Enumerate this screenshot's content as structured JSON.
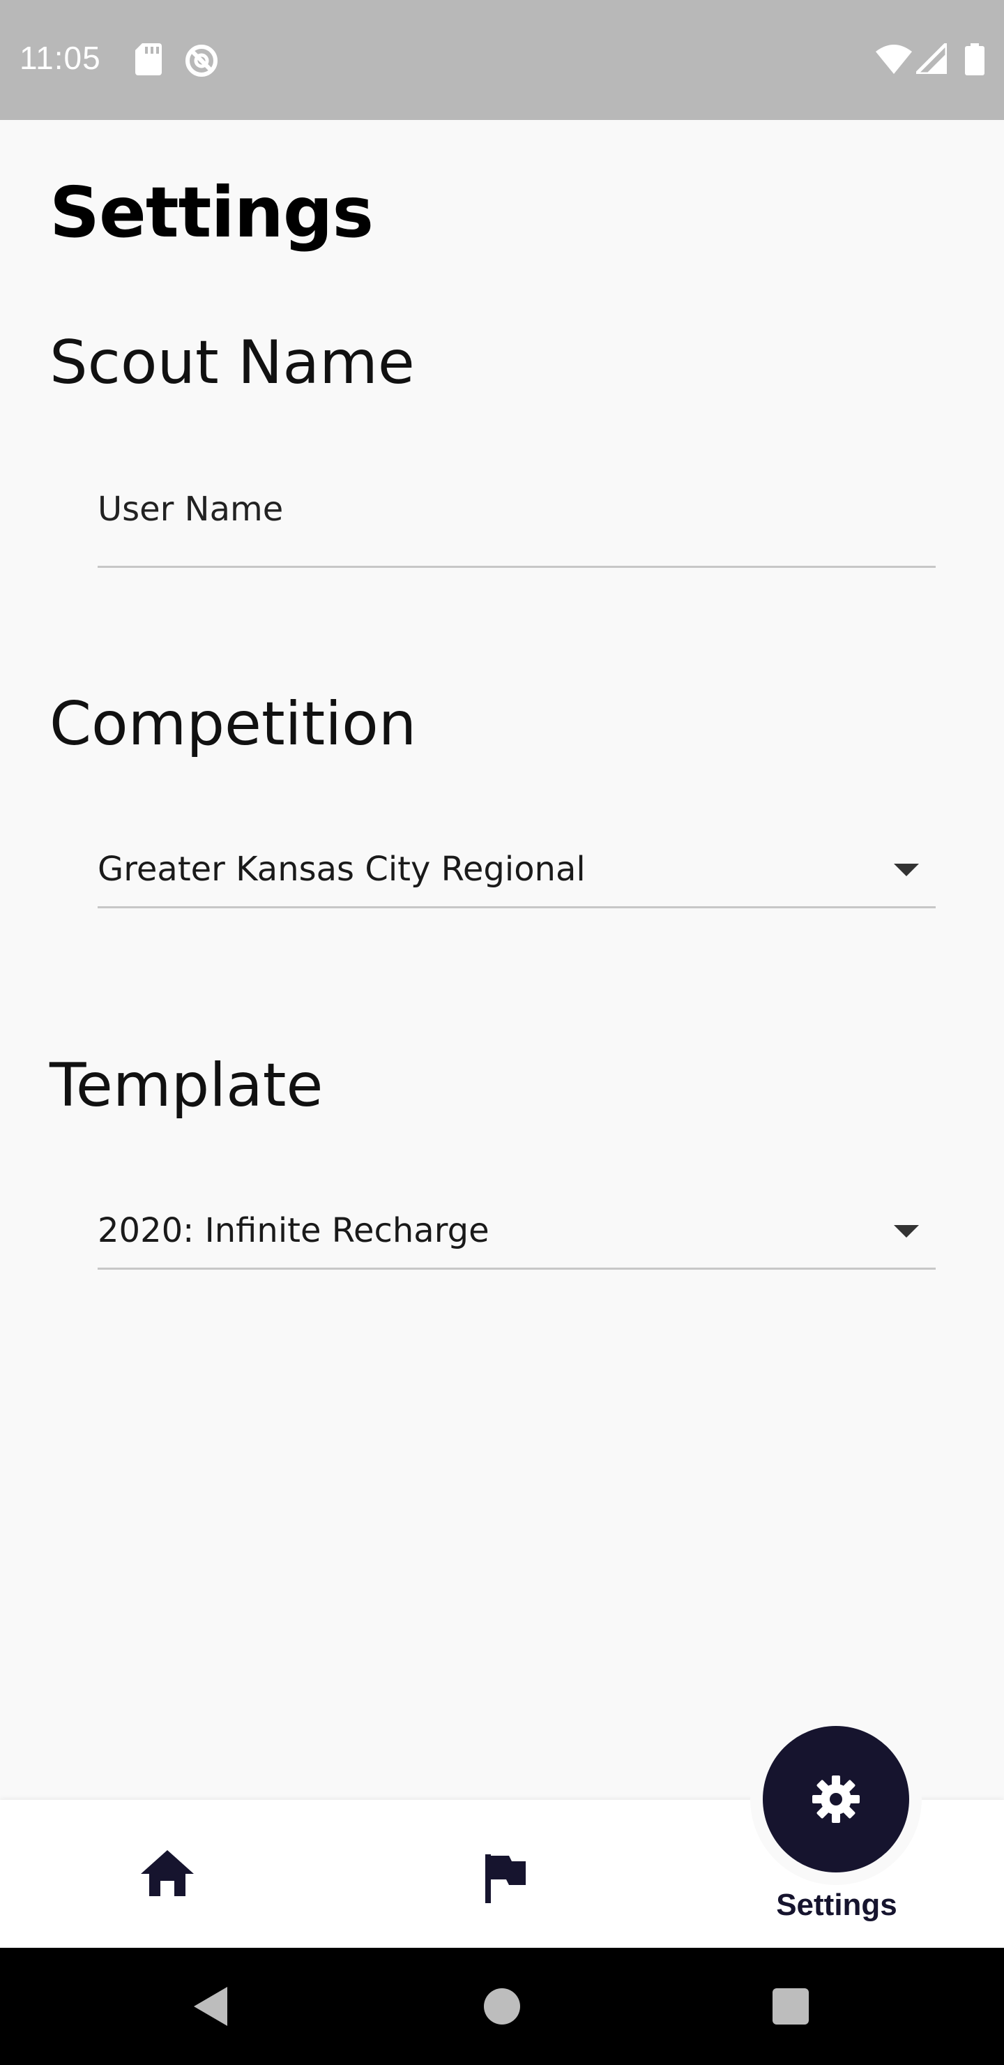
{
  "status_bar": {
    "time": "11:05",
    "icons": [
      "sd-card-icon",
      "sync-icon",
      "wifi-icon",
      "signal-icon",
      "battery-icon"
    ]
  },
  "page": {
    "title": "Settings"
  },
  "scout_name": {
    "section_title": "Scout Name",
    "input_value": "User Name"
  },
  "competition": {
    "section_title": "Competition",
    "selected_value": "Greater Kansas City Regional"
  },
  "template": {
    "section_title": "Template",
    "selected_value": "2020: Infinite Recharge"
  },
  "bottom_nav": {
    "items": [
      {
        "icon": "home-icon"
      },
      {
        "icon": "flag-icon"
      },
      {
        "icon": "gear-icon",
        "label": "Settings",
        "active": true
      }
    ]
  },
  "colors": {
    "accent": "#16142e",
    "background": "#f9f9f9",
    "status_bar": "#b8b8b8"
  }
}
